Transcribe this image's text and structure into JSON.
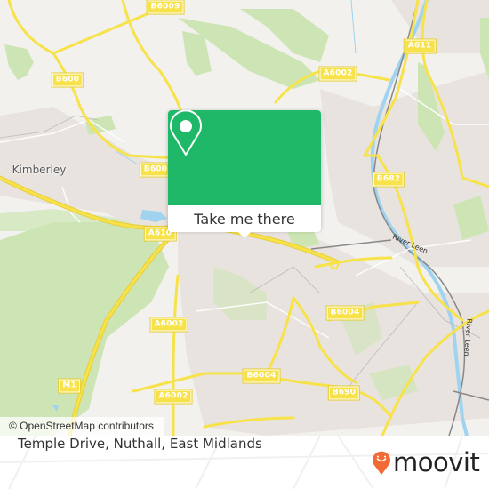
{
  "map": {
    "place_labels": [
      {
        "name": "Kimberley"
      }
    ],
    "road_labels": [
      {
        "ref": "B6009"
      },
      {
        "ref": "B600"
      },
      {
        "ref": "B600"
      },
      {
        "ref": "A6002"
      },
      {
        "ref": "A611"
      },
      {
        "ref": "B682"
      },
      {
        "ref": "A610"
      },
      {
        "ref": "A6002"
      },
      {
        "ref": "M1"
      },
      {
        "ref": "A6002"
      },
      {
        "ref": "B6004"
      },
      {
        "ref": "B6004"
      },
      {
        "ref": "B690"
      }
    ],
    "river_labels": [
      "River Leen",
      "River Leen"
    ],
    "attribution": "© OpenStreetMap contributors",
    "colors": {
      "background": "#f2f1ee",
      "park": "#cde5b4",
      "urban": "#e9e3df",
      "road": "#f7e24a",
      "water": "#9fd3ef",
      "rail": "#777777"
    }
  },
  "popup": {
    "button_label": "Take me there",
    "icon": "location-pin-icon",
    "color": "#1fb868"
  },
  "footer": {
    "address": "Temple Drive, Nuthall, East Midlands",
    "brand": "moovit",
    "brand_color": "#f26a36"
  }
}
